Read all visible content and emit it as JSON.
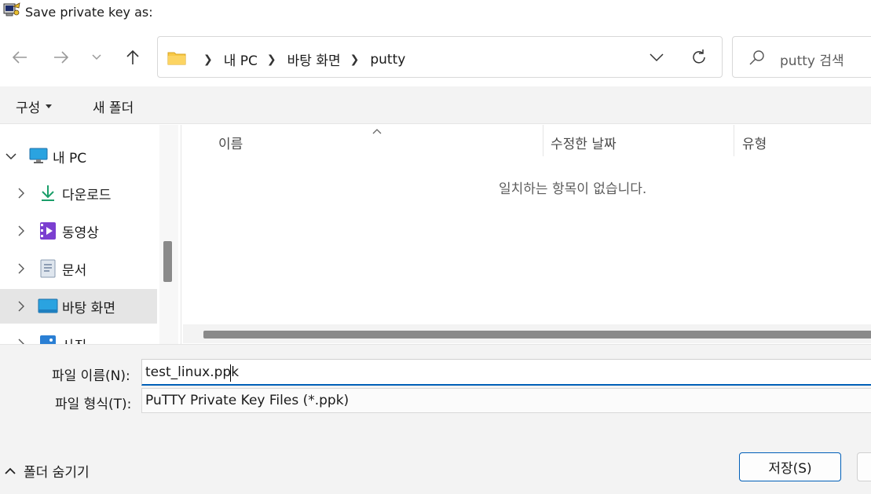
{
  "window": {
    "title": "Save private key as:"
  },
  "address": {
    "crumbs": [
      "내 PC",
      "바탕 화면",
      "putty"
    ]
  },
  "search": {
    "placeholder": "putty 검색"
  },
  "toolbar": {
    "organize_label": "구성",
    "new_folder_label": "새 폴더"
  },
  "sidebar": {
    "items": [
      {
        "label": "내 PC",
        "icon": "computer-icon",
        "expanded": true
      },
      {
        "label": "다운로드",
        "icon": "download-icon"
      },
      {
        "label": "동영상",
        "icon": "video-icon"
      },
      {
        "label": "문서",
        "icon": "document-icon"
      },
      {
        "label": "바탕 화면",
        "icon": "desktop-icon",
        "selected": true
      },
      {
        "label": "사진",
        "icon": "picture-icon"
      }
    ]
  },
  "filelist": {
    "columns": [
      "이름",
      "수정한 날짜",
      "유형"
    ],
    "empty_message": "일치하는 항목이 없습니다."
  },
  "form": {
    "filename_label": "파일 이름(N):",
    "filename_value": "test_linux.ppk",
    "filetype_label": "파일 형식(T):",
    "filetype_value": "PuTTY Private Key Files (*.ppk)"
  },
  "footer": {
    "hide_folders_label": "폴더 숨기기",
    "save_label": "저장(S)"
  },
  "colors": {
    "accent": "#005fb8",
    "selected_bg": "#e5e5e5",
    "folder": "#f8c846"
  }
}
